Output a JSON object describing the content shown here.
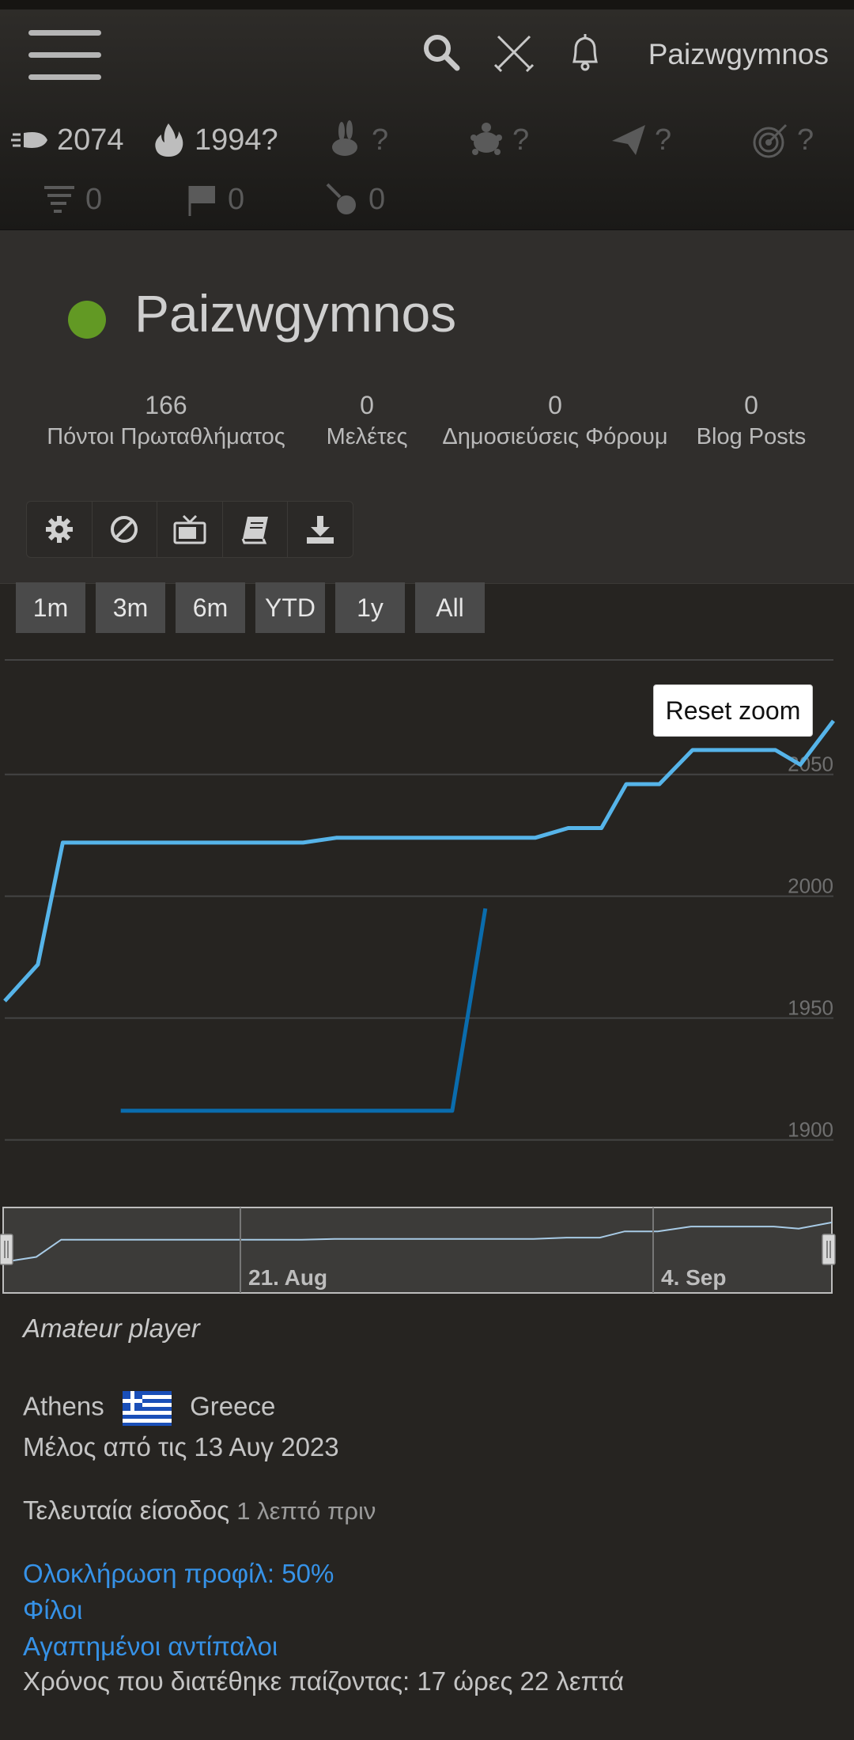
{
  "header": {
    "username": "Paizwgymnos",
    "perfs_row1": [
      {
        "icon": "bullet-icon",
        "value": "2074",
        "dim": false
      },
      {
        "icon": "blitz-fire-icon",
        "value": "1994?",
        "dim": false
      },
      {
        "icon": "rapid-rabbit-icon",
        "value": "?",
        "dim": true
      },
      {
        "icon": "classical-turtle-icon",
        "value": "?",
        "dim": true
      },
      {
        "icon": "correspondence-plane-icon",
        "value": "?",
        "dim": true
      },
      {
        "icon": "puzzle-target-icon",
        "value": "?",
        "dim": true
      }
    ],
    "perfs_row2": [
      {
        "icon": "storm-icon",
        "value": "0",
        "dim": true
      },
      {
        "icon": "racer-flag-icon",
        "value": "0",
        "dim": true
      },
      {
        "icon": "streak-icon",
        "value": "0",
        "dim": true
      }
    ]
  },
  "profile": {
    "name": "Paizwgymnos",
    "online_color": "#629924",
    "stats": [
      {
        "num": "166",
        "label": "Πόντοι Πρωταθλήματος"
      },
      {
        "num": "0",
        "label": "Μελέτες"
      },
      {
        "num": "0",
        "label": "Δημοσιεύσεις Φόρουμ"
      },
      {
        "num": "0",
        "label": "Blog Posts"
      }
    ],
    "tools": [
      "gear-icon",
      "block-icon",
      "tv-icon",
      "book-icon",
      "download-icon"
    ]
  },
  "range_buttons": [
    "1m",
    "3m",
    "6m",
    "YTD",
    "1y",
    "All"
  ],
  "reset_zoom_label": "Reset zoom",
  "chart_data": {
    "type": "line",
    "y_ticks": [
      1900,
      1950,
      2000,
      2050
    ],
    "ylim": [
      1895,
      2097
    ],
    "x_range": [
      0,
      100
    ],
    "series": [
      {
        "color": "#56b4e9",
        "points": [
          [
            0,
            1957
          ],
          [
            4,
            1972
          ],
          [
            7,
            2022
          ],
          [
            10,
            2022
          ],
          [
            20,
            2022
          ],
          [
            30,
            2022
          ],
          [
            36,
            2022
          ],
          [
            40,
            2024
          ],
          [
            50,
            2024
          ],
          [
            60,
            2024
          ],
          [
            64,
            2024
          ],
          [
            68,
            2028
          ],
          [
            72,
            2028
          ],
          [
            75,
            2046
          ],
          [
            79,
            2046
          ],
          [
            83,
            2060
          ],
          [
            88,
            2060
          ],
          [
            93,
            2060
          ],
          [
            96,
            2054
          ],
          [
            100,
            2072
          ]
        ]
      },
      {
        "color": "#0a6cad",
        "points": [
          [
            14,
            1912
          ],
          [
            20,
            1912
          ],
          [
            30,
            1912
          ],
          [
            40,
            1912
          ],
          [
            54,
            1912
          ],
          [
            58,
            1995
          ]
        ]
      }
    ],
    "navigator": {
      "labels": [
        "21. Aug",
        "4. Sep"
      ]
    }
  },
  "info": {
    "title": "Amateur player",
    "city": "Athens",
    "country": "Greece",
    "member_since": "Μέλος από τις 13 Αυγ 2023",
    "last_login_label": "Τελευταία είσοδος",
    "last_login_value": "1 λεπτό πριν",
    "profile_completion": "Ολοκλήρωση προφίλ: 50%",
    "friends": "Φίλοι",
    "favorite_opponents": "Αγαπημένοι αντίπαλοι",
    "time_playing": "Χρόνος που διατέθηκε παίζοντας: 17 ώρες 22 λεπτά"
  }
}
